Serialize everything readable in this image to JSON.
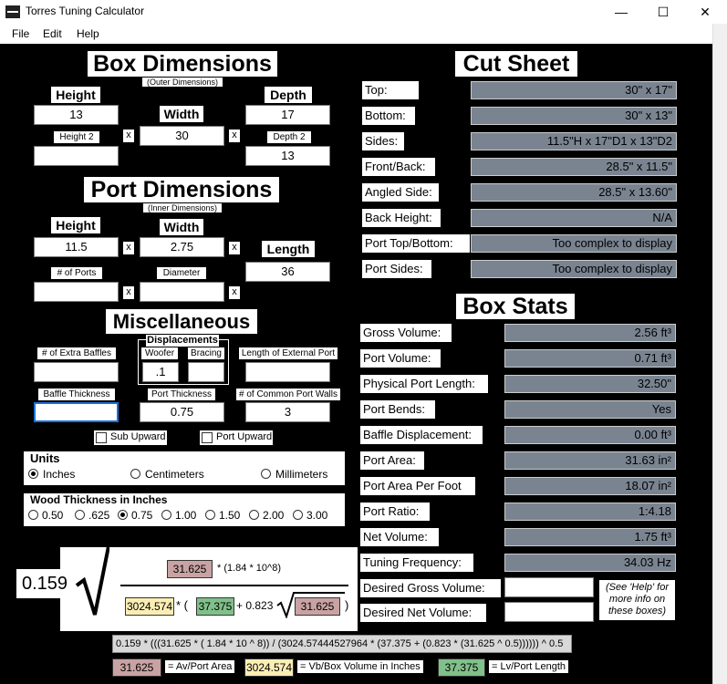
{
  "window": {
    "title": "Torres Tuning Calculator",
    "minimize": "—",
    "maximize": "☐",
    "close": "✕"
  },
  "menu": [
    "File",
    "Edit",
    "Help"
  ],
  "box": {
    "heading": "Box Dimensions",
    "subheading": "(Outer Dimensions)",
    "height_label": "Height",
    "height": "13",
    "width_label": "Width",
    "width": "30",
    "depth_label": "Depth",
    "depth": "17",
    "height2_label": "Height 2",
    "height2": "",
    "depth2_label": "Depth 2",
    "depth2": "13",
    "x": "x"
  },
  "port": {
    "heading": "Port Dimensions",
    "subheading": "(Inner Dimensions)",
    "height_label": "Height",
    "height": "11.5",
    "width_label": "Width",
    "width": "2.75",
    "length_label": "Length",
    "length": "36",
    "ports_label": "# of Ports",
    "ports": "",
    "diameter_label": "Diameter",
    "diameter": ""
  },
  "misc": {
    "heading": "Miscellaneous",
    "displacements": "Displacements",
    "woofer_label": "Woofer",
    "woofer": ".1",
    "bracing_label": "Bracing",
    "bracing": "",
    "extra_baffles_label": "# of Extra Baffles",
    "extra_baffles": "",
    "ext_port_label": "Length of External Port",
    "ext_port": "",
    "baffle_thickness_label": "Baffle Thickness",
    "baffle_thickness": "",
    "port_thickness_label": "Port Thickness",
    "port_thickness": "0.75",
    "common_walls_label": "# of Common Port Walls",
    "common_walls": "3",
    "sub_upward": "Sub Upward",
    "port_upward": "Port Upward"
  },
  "units": {
    "title": "Units",
    "options": [
      "Inches",
      "Centimeters",
      "Millimeters"
    ],
    "selected": 0
  },
  "wood": {
    "title": "Wood Thickness in Inches",
    "options": [
      "0.50",
      ".625",
      "0.75",
      "1.00",
      "1.50",
      "2.00",
      "3.00"
    ],
    "selected": 2
  },
  "cut": {
    "heading": "Cut Sheet",
    "rows": [
      {
        "label": "Top:",
        "value": "30\" x 17\""
      },
      {
        "label": "Bottom:",
        "value": "30\" x 13\""
      },
      {
        "label": "Sides:",
        "value": "11.5\"H x 17\"D1 x 13\"D2"
      },
      {
        "label": "Front/Back:",
        "value": "28.5\" x 11.5\""
      },
      {
        "label": "Angled Side:",
        "value": "28.5\" x 13.60\""
      },
      {
        "label": "Back Height:",
        "value": "N/A"
      },
      {
        "label": "Port Top/Bottom:",
        "value": "Too complex to display"
      },
      {
        "label": "Port Sides:",
        "value": "Too complex to display"
      }
    ]
  },
  "stats": {
    "heading": "Box Stats",
    "rows": [
      {
        "label": "Gross Volume:",
        "value": "2.56 ft³"
      },
      {
        "label": "Port Volume:",
        "value": "0.71 ft³"
      },
      {
        "label": "Physical Port Length:",
        "value": "32.50\""
      },
      {
        "label": "Port Bends:",
        "value": "Yes"
      },
      {
        "label": "Baffle Displacement:",
        "value": "0.00 ft³"
      },
      {
        "label": "Port Area:",
        "value": "31.63 in²"
      },
      {
        "label": "Port Area Per Foot",
        "value": "18.07 in²"
      },
      {
        "label": "Port Ratio:",
        "value": "1:4.18"
      },
      {
        "label": "Net Volume:",
        "value": "1.75 ft³"
      },
      {
        "label": "Tuning Frequency:",
        "value": "34.03 Hz"
      }
    ],
    "desired_gross_label": "Desired Gross Volume:",
    "desired_net_label": "Desired Net Volume:",
    "desired_gross": "",
    "desired_net": "",
    "help_note": "(See 'Help' for more info on these boxes)"
  },
  "formula": {
    "coef": "0.159",
    "av": "31.625",
    "factor": "* (1.84 * 10^8)",
    "vb": "3024.574",
    "star_paren": "* (",
    "lv": "37.375",
    "plus": "+ 0.823",
    "close": ")",
    "expression": "0.159 * (((31.625 * ( 1.84 * 10 ^ 8)) / (3024.57444527964 * (37.375 + (0.823 * (31.625 ^ 0.5)))))) ^ 0.5",
    "legend_av": "= Av/Port Area",
    "legend_vb": "= Vb/Box Volume in Inches",
    "legend_lv": "= Lv/Port Length"
  }
}
